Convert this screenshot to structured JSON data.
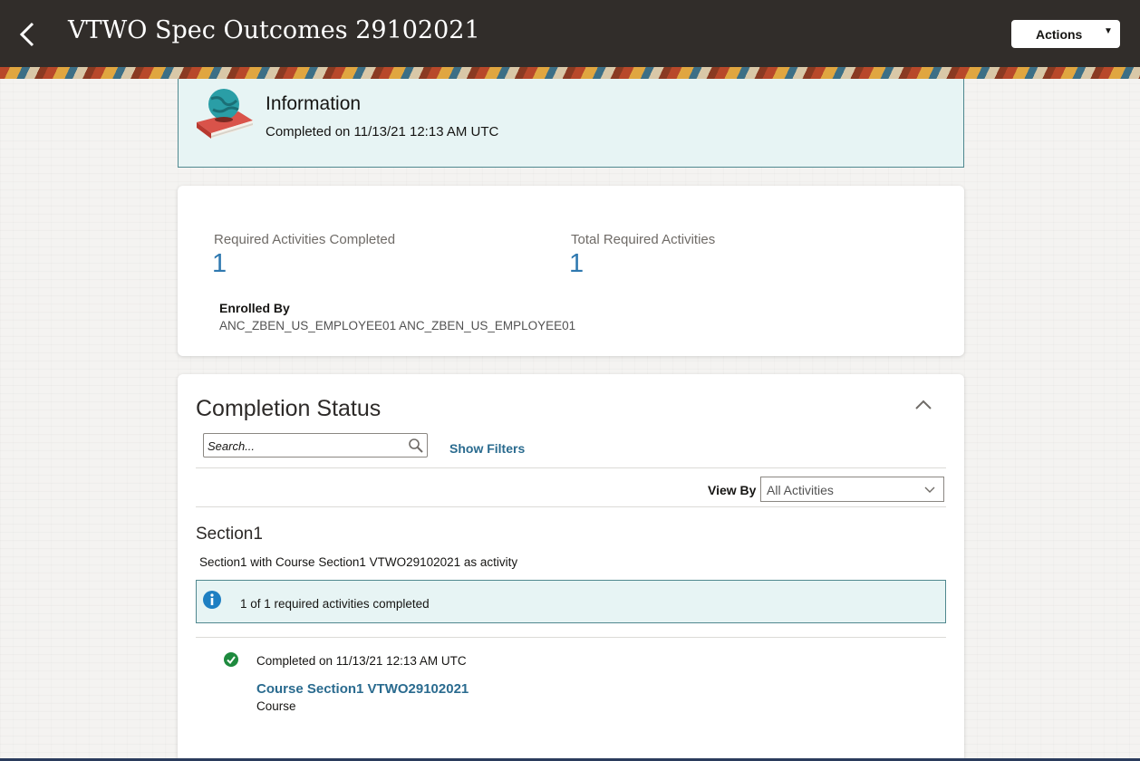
{
  "header": {
    "title": "VTWO Spec Outcomes 29102021",
    "actions_label": "Actions"
  },
  "info": {
    "title": "Information",
    "subtitle": "Completed on 11/13/21 12:13 AM UTC"
  },
  "metrics": {
    "required_completed_label": "Required Activities Completed",
    "required_completed_value": "1",
    "total_required_label": "Total Required Activities",
    "total_required_value": "1",
    "enrolled_by_label": "Enrolled By",
    "enrolled_by_value": "ANC_ZBEN_US_EMPLOYEE01 ANC_ZBEN_US_EMPLOYEE01"
  },
  "completion": {
    "title": "Completion Status",
    "search_placeholder": "Search...",
    "show_filters_label": "Show Filters",
    "view_by_label": "View By",
    "view_by_value": "All Activities",
    "section": {
      "title": "Section1",
      "description": "Section1 with Course Section1 VTWO29102021 as activity",
      "notice": "1 of 1 required activities completed",
      "activity": {
        "status": "Completed on 11/13/21 12:13 AM UTC",
        "name": "Course Section1 VTWO29102021",
        "type": "Course"
      }
    }
  },
  "colors": {
    "header_bg": "#312d2a",
    "info_bg": "#e7f4f4",
    "link": "#2a6b8f",
    "metric_value": "#2f79b0",
    "success": "#1e8a3e"
  },
  "icons": {
    "back": "back-arrow-icon",
    "book": "book-globe-icon",
    "collapse": "chevron-up-icon",
    "search": "search-icon",
    "info": "info-icon",
    "check": "check-circle-icon"
  }
}
